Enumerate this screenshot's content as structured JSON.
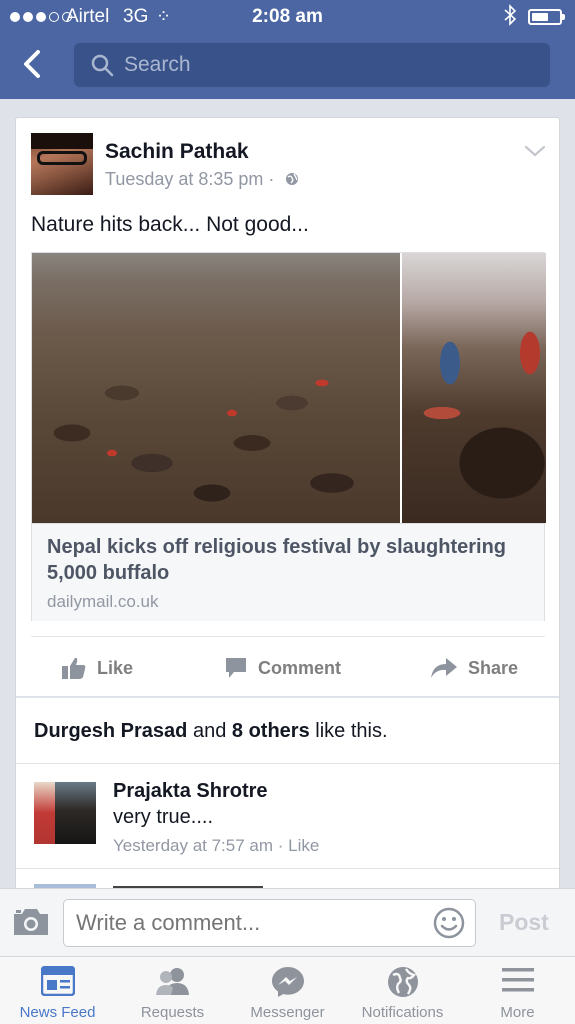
{
  "status_bar": {
    "carrier": "Airtel",
    "network": "3G",
    "time": "2:08 am"
  },
  "header": {
    "search_placeholder": "Search"
  },
  "post": {
    "author": "Sachin Pathak",
    "timestamp": "Tuesday at 8:35 pm ·",
    "text": "Nature hits back... Not good...",
    "link": {
      "title": "Nepal kicks off religious festival by slaughtering 5,000 buffalo",
      "domain": "dailymail.co.uk"
    },
    "actions": {
      "like": "Like",
      "comment": "Comment",
      "share": "Share"
    },
    "likes": {
      "first_name": "Durgesh Prasad",
      "joiner": "and",
      "others": "8 others",
      "suffix": "like this."
    }
  },
  "comments": [
    {
      "author": "Prajakta Shrotre",
      "text": "very true....",
      "time": "Yesterday at 7:57 am",
      "like_label": "· Like"
    }
  ],
  "composer": {
    "placeholder": "Write a comment...",
    "post_label": "Post"
  },
  "tabs": [
    {
      "label": "News Feed",
      "icon": "news-feed-icon",
      "active": true
    },
    {
      "label": "Requests",
      "icon": "requests-icon"
    },
    {
      "label": "Messenger",
      "icon": "messenger-icon"
    },
    {
      "label": "Notifications",
      "icon": "notifications-icon"
    },
    {
      "label": "More",
      "icon": "more-icon"
    }
  ],
  "colors": {
    "header": "#4b66a2",
    "search": "#39528a",
    "active_tab": "#4a78c8",
    "muted": "#9197a3"
  }
}
